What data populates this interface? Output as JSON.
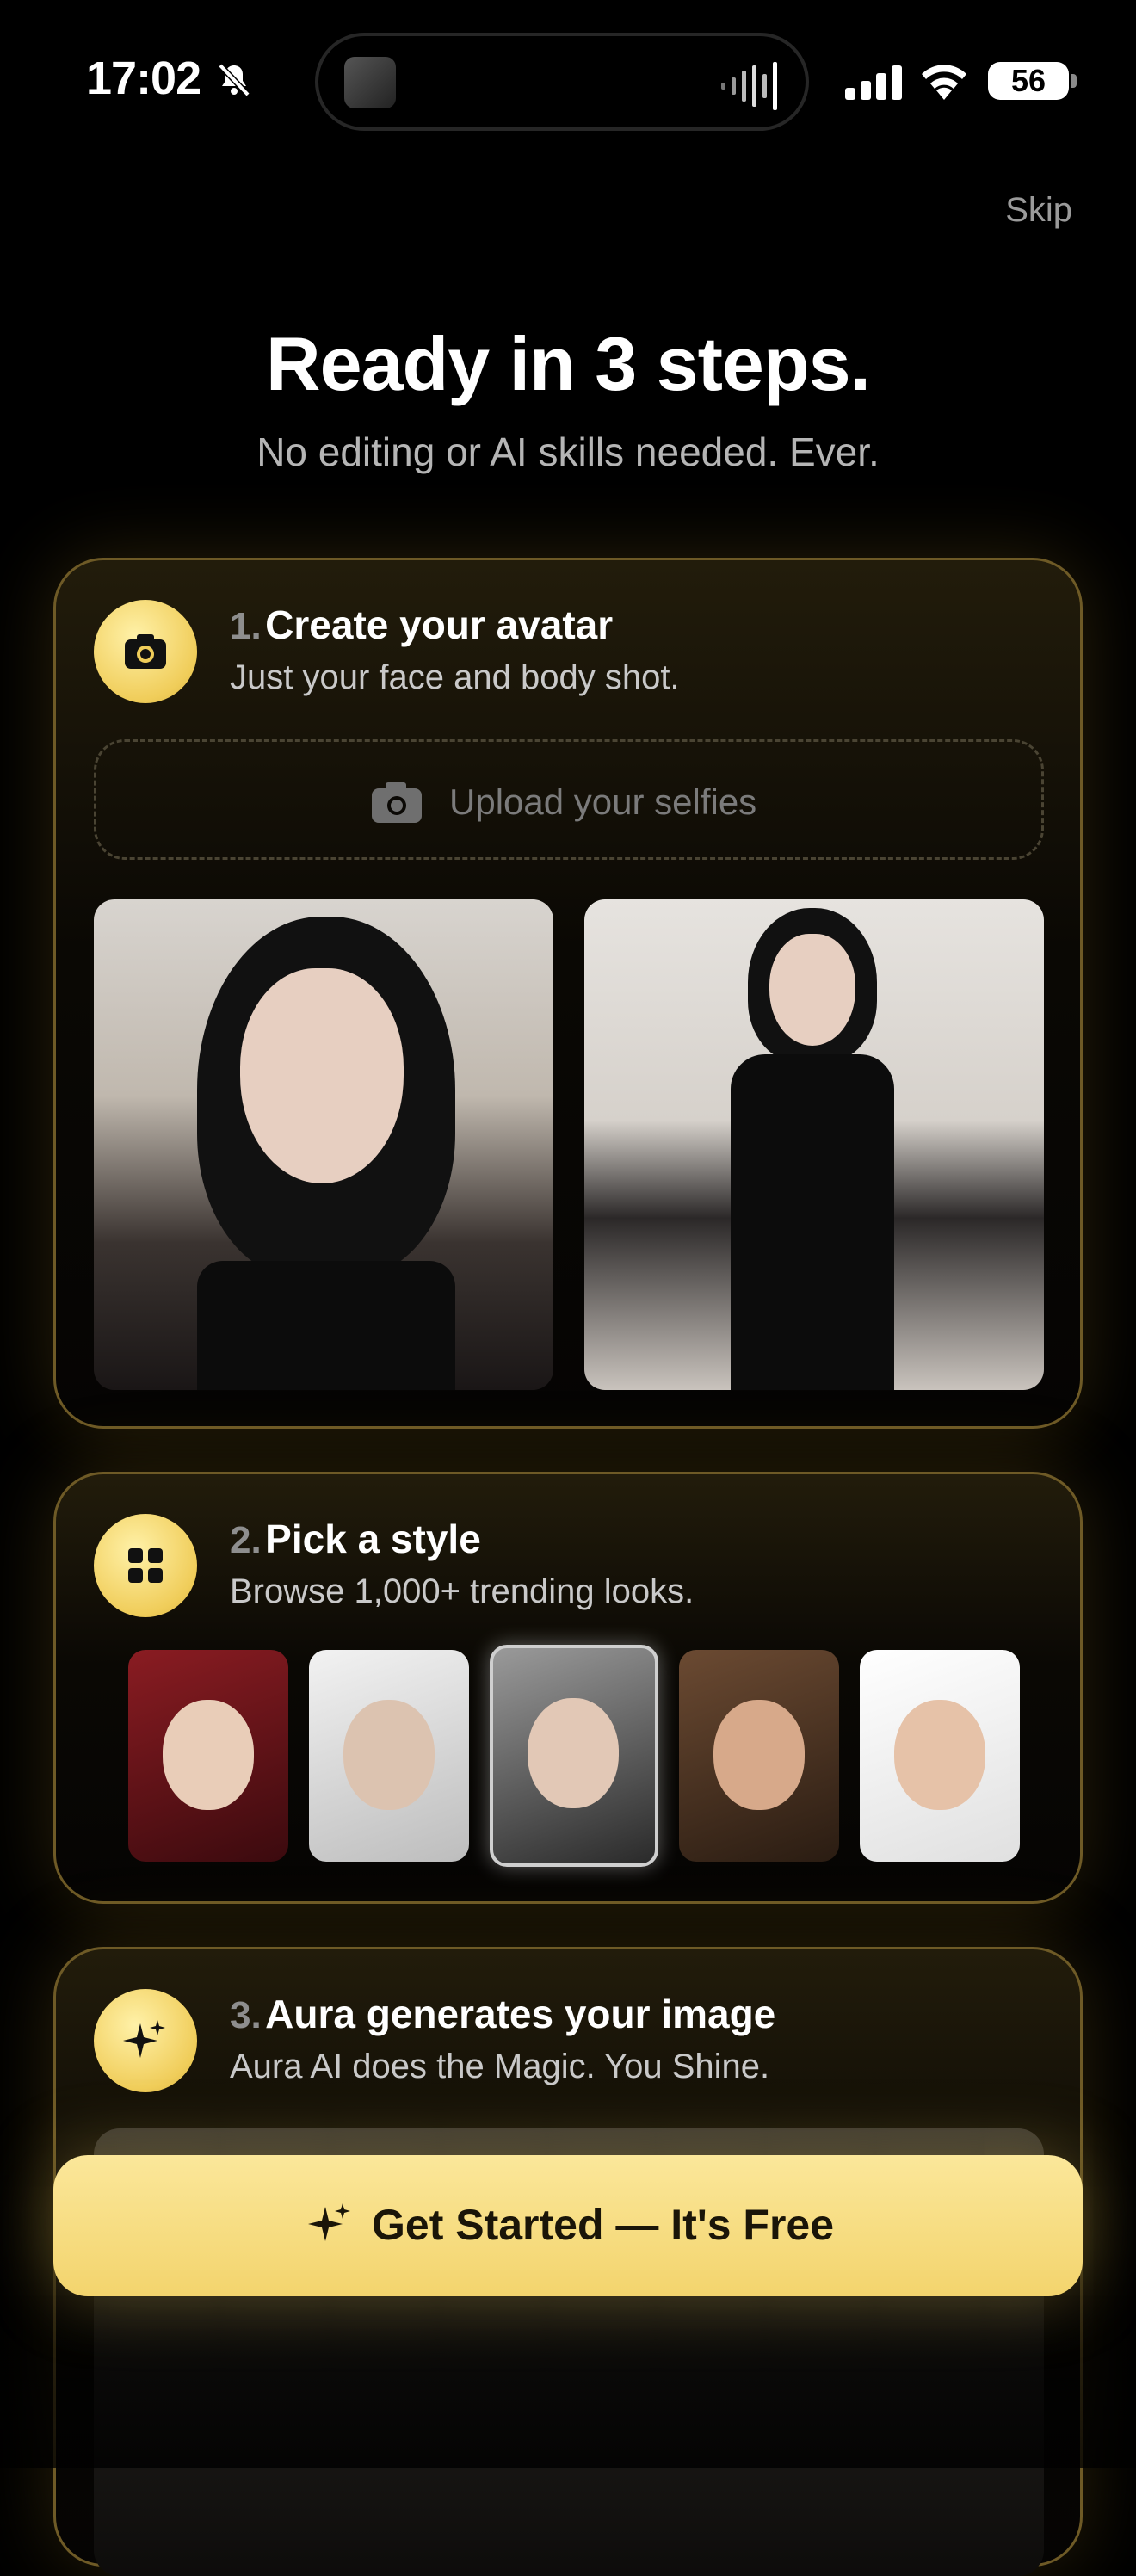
{
  "status_bar": {
    "time": "17:02",
    "battery": "56",
    "icons": [
      "bell-slash-icon",
      "cellular-signal-icon",
      "wifi-icon",
      "battery-icon"
    ]
  },
  "header": {
    "skip_label": "Skip",
    "title": "Ready in 3 steps.",
    "subtitle": "No editing or AI skills needed. Ever."
  },
  "steps": [
    {
      "number": "1.",
      "title": "Create your avatar",
      "description": "Just your face and body shot.",
      "icon": "camera-icon",
      "upload_label": "Upload your selfies"
    },
    {
      "number": "2.",
      "title": "Pick a style",
      "description": "Browse 1,000+ trending looks.",
      "icon": "grid-icon"
    },
    {
      "number": "3.",
      "title": "Aura generates your image",
      "description": "Aura AI does the Magic. You Shine.",
      "icon": "sparkles-icon"
    }
  ],
  "cta": {
    "label": "Get Started — It's Free",
    "icon": "sparkles-icon"
  },
  "colors": {
    "background": "#000000",
    "accent_gold": "#F3D46D",
    "card_border": "#6E5A26"
  }
}
